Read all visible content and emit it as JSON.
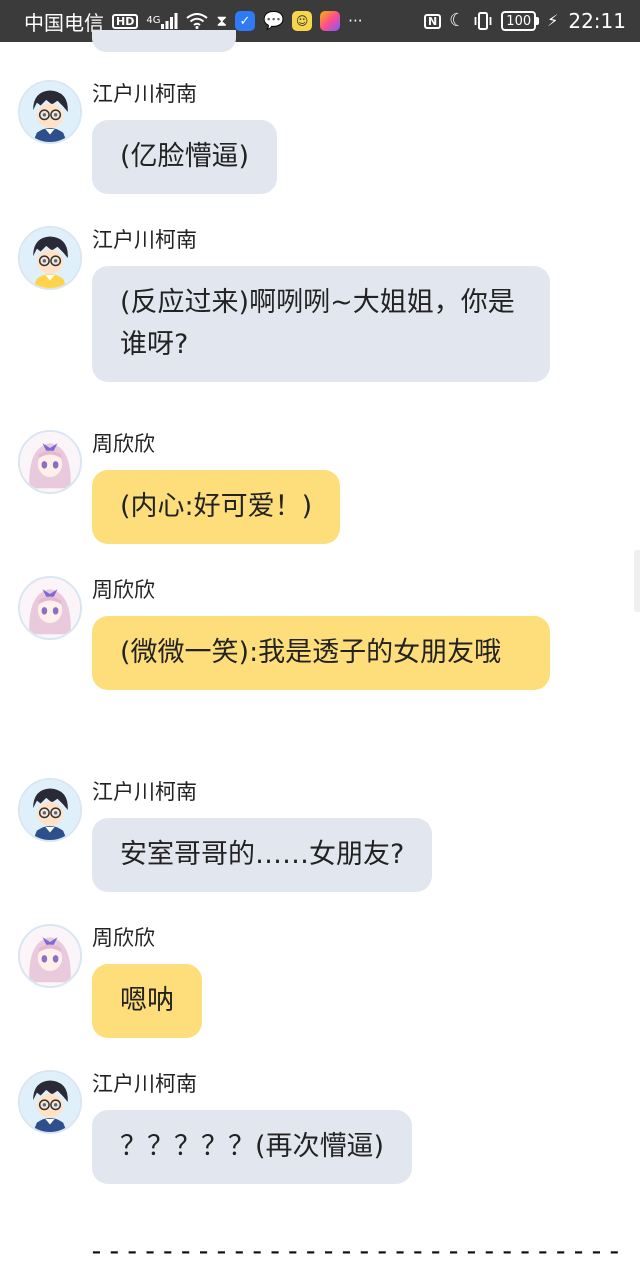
{
  "status_bar": {
    "carrier": "中国电信",
    "hd": "HD",
    "network": "4G",
    "battery": "100",
    "time": "22:11",
    "icons": [
      "signal-icon",
      "wifi-icon",
      "hourglass-icon",
      "shield-icon",
      "wechat-icon",
      "app-icon",
      "app-icon",
      "more-icon",
      "nfc-icon",
      "moon-icon",
      "vibrate-icon",
      "battery-icon",
      "charging-icon"
    ]
  },
  "messages": [
    {
      "sender": "江户川柯南",
      "text": "(亿脸懵逼)",
      "role": "conan"
    },
    {
      "sender": "江户川柯南",
      "text": "(反应过来)啊咧咧~大姐姐，你是谁呀?",
      "role": "conan"
    },
    {
      "sender": "周欣欣",
      "text": "(内心:好可爱！)",
      "role": "girl"
    },
    {
      "sender": "周欣欣",
      "text": "(微微一笑):我是透子的女朋友哦",
      "role": "girl"
    },
    {
      "sender": "江户川柯南",
      "text": "安室哥哥的……女朋友?",
      "role": "conan"
    },
    {
      "sender": "周欣欣",
      "text": "嗯呐",
      "role": "girl"
    },
    {
      "sender": "江户川柯南",
      "text": "？？？？？(再次懵逼)",
      "role": "conan"
    }
  ],
  "divider": "------------------------------",
  "colors": {
    "conan_bubble": "#e2e7ef",
    "girl_bubble": "#fdde7a",
    "status_bar": "#3b3b3b"
  }
}
